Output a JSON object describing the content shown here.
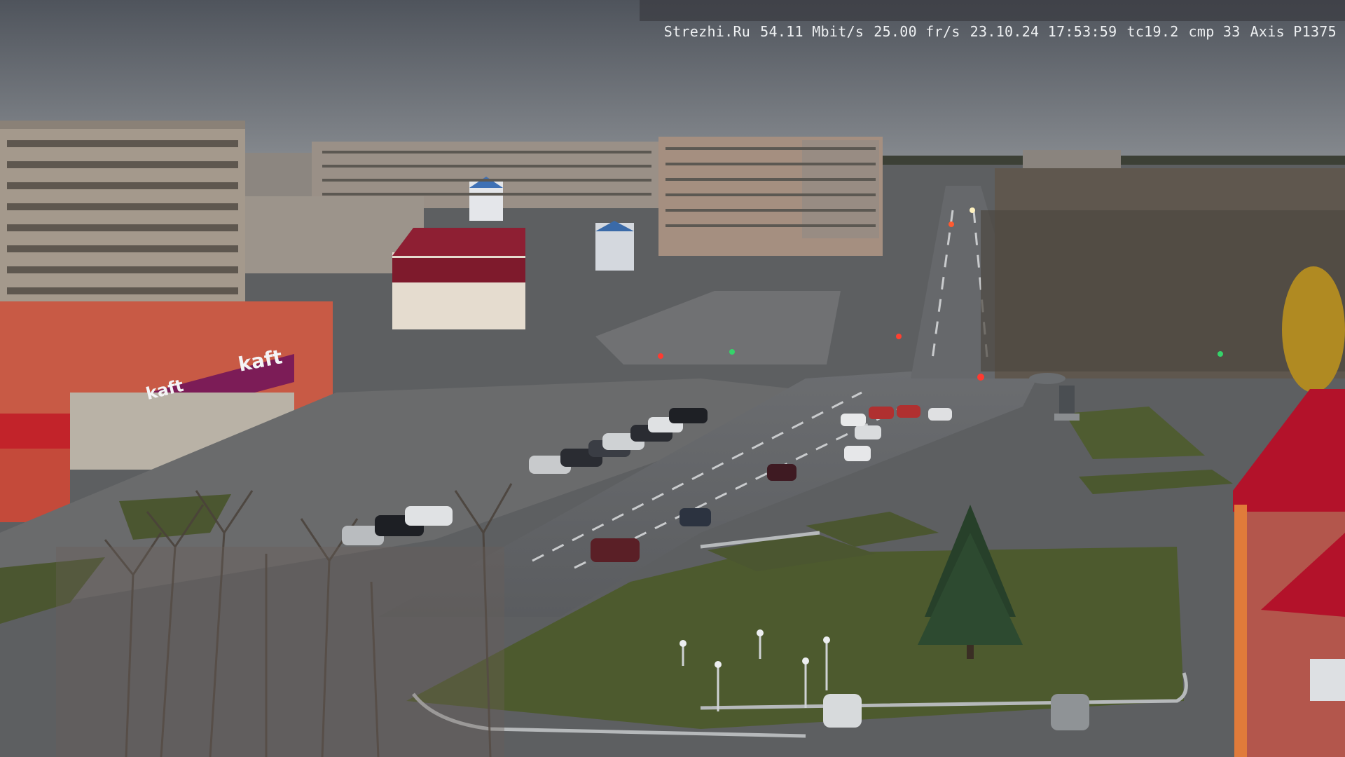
{
  "image": {
    "kind": "outdoor city webcam still",
    "scene": "dusk view of a town square intersection with apartment blocks, parking lot and tree-lined avenue"
  },
  "overlay": {
    "site": "Strezhi.Ru",
    "bitrate": "54.11 Mbit/s",
    "framerate": "25.00 fr/s",
    "datetime": "23.10.24 17:53:59",
    "tc": "tc19.2",
    "cmp": "cmp 33",
    "camera": "Axis P1375"
  },
  "signs": {
    "store_main": "kaft",
    "store_front": "kaft"
  },
  "colors": {
    "sky": "#6e747c",
    "store_red": "#c0392b",
    "store_magenta": "#8b1f5f",
    "roof_red": "#b3122a",
    "grass": "#4d5a2e"
  }
}
